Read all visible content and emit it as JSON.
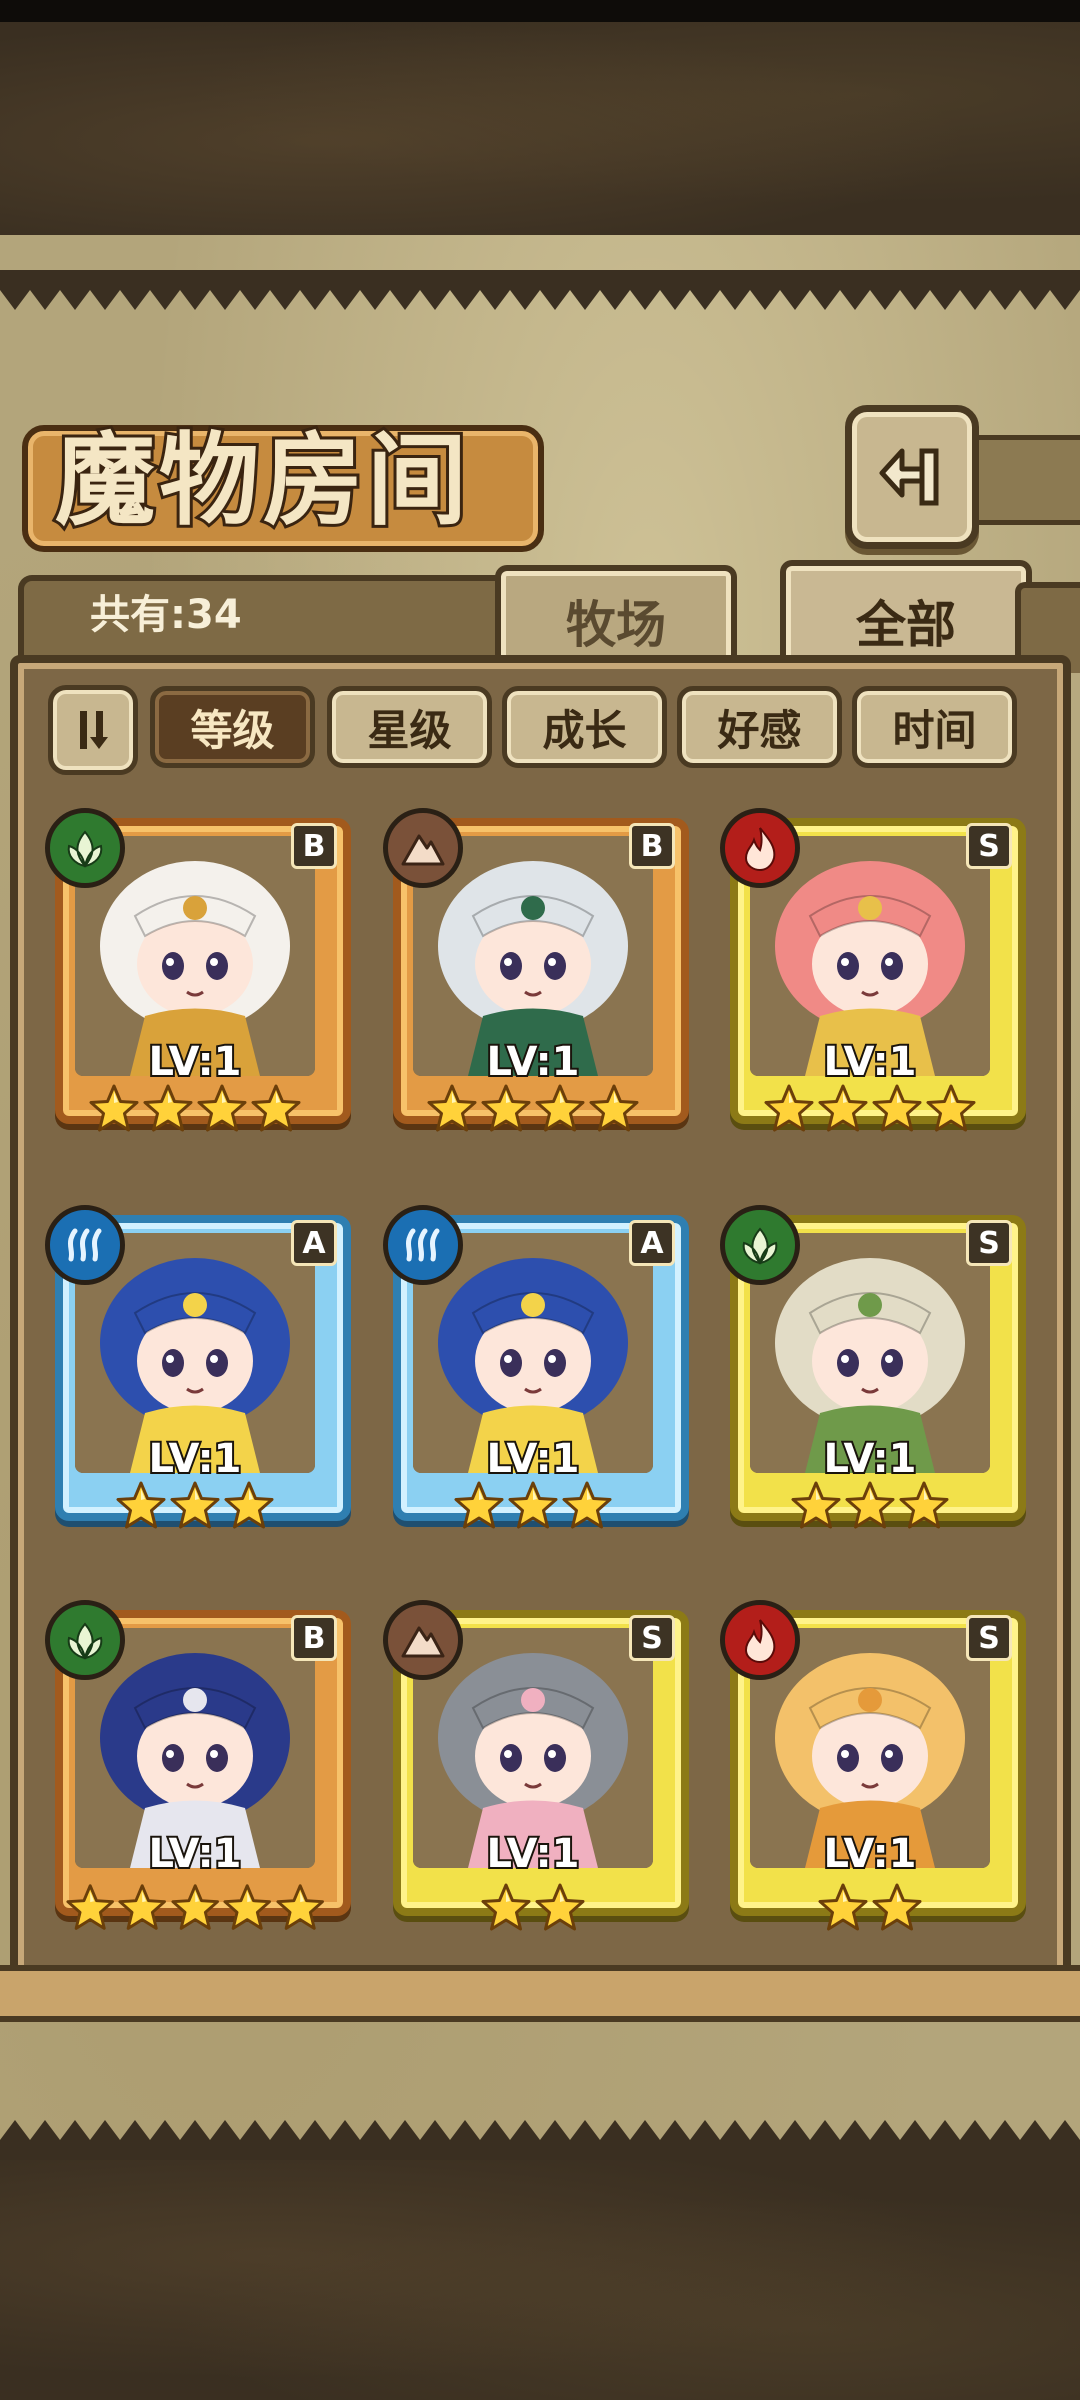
{
  "header": {
    "title": "魔物房间",
    "back_icon": "back-arrow-icon"
  },
  "tabs": {
    "count_label": "共有:34",
    "items": [
      {
        "label": "牧场",
        "active": false
      },
      {
        "label": "全部",
        "active": true
      }
    ]
  },
  "sort_bar": {
    "toggle_icon": "sort-order-icon",
    "buttons": [
      {
        "label": "等级",
        "active": true
      },
      {
        "label": "星级",
        "active": false
      },
      {
        "label": "成长",
        "active": false
      },
      {
        "label": "好感",
        "active": false
      },
      {
        "label": "时间",
        "active": false
      }
    ]
  },
  "monsters": [
    {
      "rank": "B",
      "element": "nature",
      "level": "LV:1",
      "stars": 4,
      "frame": "bronze",
      "hair": "#f4f1ec",
      "accent": "#d9a23a"
    },
    {
      "rank": "B",
      "element": "earth",
      "level": "LV:1",
      "stars": 4,
      "frame": "bronze",
      "hair": "#dfe4e8",
      "accent": "#2f6b4b"
    },
    {
      "rank": "S",
      "element": "fire",
      "level": "LV:1",
      "stars": 4,
      "frame": "gold",
      "hair": "#f08a86",
      "accent": "#e8c04a"
    },
    {
      "rank": "A",
      "element": "water",
      "level": "LV:1",
      "stars": 3,
      "frame": "blue",
      "hair": "#2d4fae",
      "accent": "#f3d34a"
    },
    {
      "rank": "A",
      "element": "water",
      "level": "LV:1",
      "stars": 3,
      "frame": "blue",
      "hair": "#2d4fae",
      "accent": "#f3d34a"
    },
    {
      "rank": "S",
      "element": "nature",
      "level": "LV:1",
      "stars": 3,
      "frame": "gold",
      "hair": "#e2dcc6",
      "accent": "#6f9a4a"
    },
    {
      "rank": "B",
      "element": "nature",
      "level": "LV:1",
      "stars": 5,
      "frame": "bronze",
      "hair": "#2a3a8a",
      "accent": "#e6e6ee"
    },
    {
      "rank": "S",
      "element": "earth",
      "level": "LV:1",
      "stars": 2,
      "frame": "gold",
      "hair": "#8a8f96",
      "accent": "#f0b0c0"
    },
    {
      "rank": "S",
      "element": "fire",
      "level": "LV:1",
      "stars": 2,
      "frame": "gold",
      "hair": "#f3c16a",
      "accent": "#e59a3a"
    }
  ]
}
